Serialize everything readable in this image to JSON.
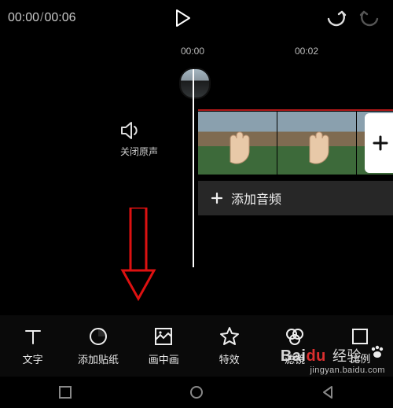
{
  "time": {
    "current": "00:00",
    "total": "00:06"
  },
  "ruler": {
    "t1": "00:00",
    "t2": "00:02"
  },
  "mute": {
    "label": "关闭原声"
  },
  "audio": {
    "label": "添加音频"
  },
  "tools": [
    {
      "label": "文字"
    },
    {
      "label": "添加贴纸"
    },
    {
      "label": "画中画"
    },
    {
      "label": "特效"
    },
    {
      "label": "滤镜"
    },
    {
      "label": "比例"
    }
  ],
  "watermark": {
    "brand": "Bai",
    "brand2": "du",
    "suffix": "经验",
    "url": "jingyan.baidu.com"
  }
}
